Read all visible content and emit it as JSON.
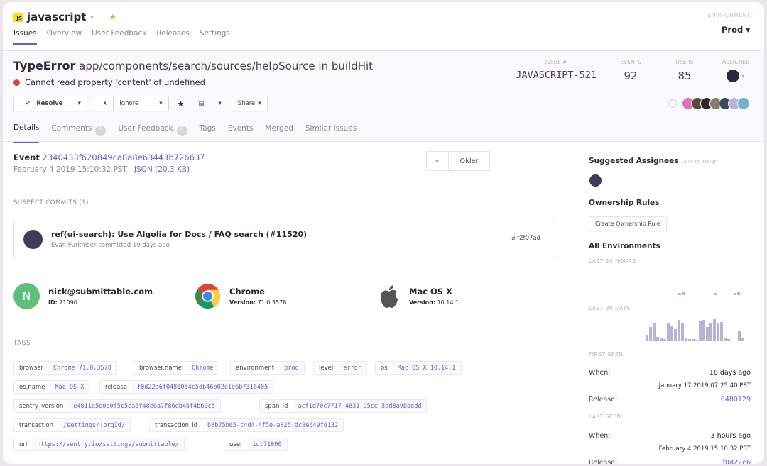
{
  "project": {
    "badge": "JS",
    "name": "javascript"
  },
  "nav": [
    "Issues",
    "Overview",
    "User Feedback",
    "Releases",
    "Settings"
  ],
  "environment": {
    "label": "ENVIRONMENT",
    "value": "Prod"
  },
  "issue": {
    "type": "TypeError",
    "location": "app/components/search/sources/helpSource in buildHit",
    "message": "Cannot read property 'content' of undefined",
    "stats": [
      {
        "label": "ISSUE #",
        "value": "JAVASCRIPT-521"
      },
      {
        "label": "EVENTS",
        "value": "92"
      },
      {
        "label": "USERS",
        "value": "85"
      },
      {
        "label": "ASSIGNEE",
        "value": ""
      }
    ]
  },
  "toolbar": {
    "resolve": "Resolve",
    "ignore": "Ignore",
    "share": "Share"
  },
  "tabs": [
    {
      "label": "Details"
    },
    {
      "label": "Comments",
      "count": "0"
    },
    {
      "label": "User Feedback",
      "count": "0"
    },
    {
      "label": "Tags"
    },
    {
      "label": "Events"
    },
    {
      "label": "Merged"
    },
    {
      "label": "Similar Issues"
    }
  ],
  "event": {
    "label": "Event",
    "id": "2340433f620849ca8a8e63443b726637",
    "date": "February 4 2019 15:10:32 PST",
    "json": "JSON (20.3 KB)",
    "newer": "«",
    "older": "Older"
  },
  "suspect_commits": {
    "heading": "SUSPECT COMMITS (1)",
    "message": "ref(ui-search): Use Algolia for Docs / FAQ search (#11520)",
    "author": "Evan Purkhiser",
    "committed": "committed 19 days ago",
    "sha": "f2f07ad"
  },
  "context": [
    {
      "name": "nick@submittable.com",
      "sub_label": "ID:",
      "sub_value": "71090",
      "icon": "user-avatar",
      "initial": "N"
    },
    {
      "name": "Chrome",
      "sub_label": "Version:",
      "sub_value": "71.0.3578",
      "icon": "chrome-icon"
    },
    {
      "name": "Mac OS X",
      "sub_label": "Version:",
      "sub_value": "10.14.1",
      "icon": "apple-icon"
    }
  ],
  "tags_heading": "TAGS",
  "tags": [
    {
      "k": "browser",
      "v": "Chrome 71.0.3578"
    },
    {
      "k": "browser.name",
      "v": "Chrome"
    },
    {
      "k": "environment",
      "v": "prod"
    },
    {
      "k": "level",
      "v": "error"
    },
    {
      "k": "os",
      "v": "Mac OS X 10.14.1"
    },
    {
      "k": "os.name",
      "v": "Mac OS X"
    },
    {
      "k": "release",
      "v": "f0d22e6f0481054c5db46b02e1e6b7316405"
    },
    {
      "k": "sentry_version",
      "v": "e4811e5e0b0f5c5ea6f48e6a7f86eb46f4b60c5"
    },
    {
      "k": "span_id",
      "v": "acf1d70c7717 4831 95cc 5ad8a9bbedd"
    },
    {
      "k": "transaction",
      "v": "/settings/:orgId/"
    },
    {
      "k": "transaction_id",
      "v": "b8b75b65-c4d4-4f5e-a825-dc3e649f6132"
    },
    {
      "k": "url",
      "v": "https://sentry.io/settings/submittable/"
    },
    {
      "k": "user",
      "v": "id:71090"
    }
  ],
  "sidebar": {
    "suggested": "Suggested Assignees",
    "suggested_hint": "Click to assign",
    "ownership": "Ownership Rules",
    "create_rule": "Create Ownership Rule",
    "all_envs": "All Environments",
    "last24": "LAST 24 HOURS",
    "last30": "LAST 30 DAYS",
    "first_seen": "FIRST SEEN",
    "last_seen": "LAST SEEN",
    "when": "When:",
    "release": "Release:",
    "first_when": "18 days ago",
    "first_date": "January 17 2019 07:25:40 PST",
    "first_release": "0480129",
    "last_when": "3 hours ago",
    "last_date": "February 4 2019 15:10:32 PST",
    "last_release": "f0d22e6"
  },
  "colors": {
    "accent": "#6c5fc7",
    "error": "#e03e2f"
  }
}
